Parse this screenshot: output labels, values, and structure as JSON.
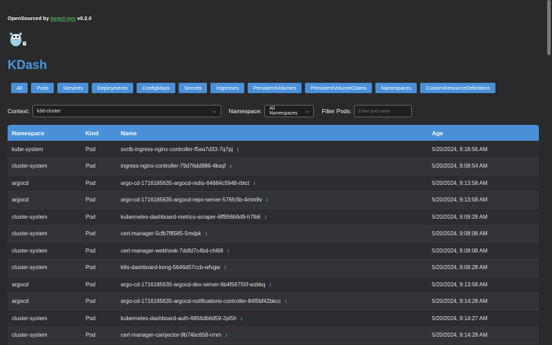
{
  "header": {
    "prefix": "OpenSourced by",
    "link": "target-ops",
    "version": "v0.2.0"
  },
  "app_title": "KDash",
  "tabs": [
    "All",
    "Pods",
    "Services",
    "Deployments",
    "ConfigMaps",
    "Secrets",
    "Ingresses",
    "PersistentVolumes",
    "PersistentVolumeClaims",
    "Namespaces",
    "CustomResourceDefinitions"
  ],
  "filters": {
    "context_label": "Context:",
    "context_value": "k3d-cluster",
    "namespace_label": "Namespace:",
    "namespace_value": "All Namespaces",
    "pod_filter_label": "Filter Pods:",
    "pod_filter_placeholder": "Enter pod name",
    "pod_filter_value": ""
  },
  "table": {
    "columns": [
      "Namespace",
      "Kind",
      "Name",
      "Age"
    ],
    "rows": [
      {
        "namespace": "kube-system",
        "kind": "Pod",
        "name": "svclb-ingress-nginx-controller-f5ea7d33-7q7pj",
        "age": "5/20/2024, 9:18:56 AM"
      },
      {
        "namespace": "cluster-system",
        "kind": "Pod",
        "name": "ingress-nginx-controller-79d76dd986-4ksqf",
        "age": "5/20/2024, 9:08:54 AM"
      },
      {
        "namespace": "argocd",
        "kind": "Pod",
        "name": "argo-cd-1716185635-argocd-redis-64684c5948-rbtct",
        "age": "5/20/2024, 9:13:58 AM"
      },
      {
        "namespace": "argocd",
        "kind": "Pod",
        "name": "argo-cd-1716185635-argocd-repo-server-576fc5b-4mm9v",
        "age": "5/20/2024, 9:13:58 AM"
      },
      {
        "namespace": "cluster-system",
        "kind": "Pod",
        "name": "kubernetes-dashboard-metrics-scraper-6ff956b9d9-h7lb6",
        "age": "5/20/2024, 9:09:28 AM"
      },
      {
        "namespace": "cluster-system",
        "kind": "Pod",
        "name": "cert-manager-5cfb7f8585-5mdpk",
        "age": "5/20/2024, 9:08:08 AM"
      },
      {
        "namespace": "cluster-system",
        "kind": "Pod",
        "name": "cert-manager-webhook-7ddfd7c4bd-chl68",
        "age": "5/20/2024, 9:08:08 AM"
      },
      {
        "namespace": "cluster-system",
        "kind": "Pod",
        "name": "k8s-dashboard-kong-5646d57ccb-wfvgw",
        "age": "5/20/2024, 9:09:28 AM"
      },
      {
        "namespace": "argocd",
        "kind": "Pod",
        "name": "argo-cd-1716185635-argocd-dex-server-6b4f56755f-wzkkq",
        "age": "5/20/2024, 9:13:58 AM"
      },
      {
        "namespace": "argocd",
        "kind": "Pod",
        "name": "argo-cd-1716185635-argocd-notifications-controller-84f5bf42bkcc",
        "age": "5/20/2024, 9:14:28 AM"
      },
      {
        "namespace": "cluster-system",
        "kind": "Pod",
        "name": "kubernetes-dashboard-auth-6856db6d59-2pl5h",
        "age": "5/20/2024, 9:14:27 AM"
      },
      {
        "namespace": "cluster-system",
        "kind": "Pod",
        "name": "cert-manager-cainjector-9b74bc658-rrnm",
        "age": "5/20/2024, 9:14:28 AM"
      }
    ]
  },
  "icons": {
    "info": "info-icon",
    "logo": "gopher-logo-icon"
  },
  "colors": {
    "accent": "#4a90d9",
    "title": "#4a96d9",
    "link": "#4caf50",
    "background": "#2a2a2d"
  }
}
